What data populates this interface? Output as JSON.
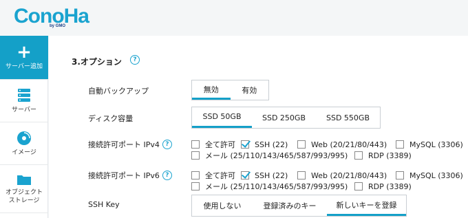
{
  "logo": {
    "text": "ConoHa",
    "sub": "by GMO"
  },
  "sidebar": {
    "items": [
      {
        "label": "サーバー追加",
        "icon": "plus-icon"
      },
      {
        "label": "サーバー",
        "icon": "server-icon"
      },
      {
        "label": "イメージ",
        "icon": "disc-icon"
      },
      {
        "label": "オブジェクト\nストレージ",
        "icon": "folder-icon"
      }
    ]
  },
  "section": {
    "title": "3.オプション",
    "help": "?"
  },
  "auto_backup": {
    "label": "自動バックアップ",
    "options": [
      "無効",
      "有効"
    ],
    "selected": 0
  },
  "disk": {
    "label": "ディスク容量",
    "options": [
      "SSD 50GB",
      "SSD 250GB",
      "SSD 550GB"
    ],
    "selected": 0
  },
  "ipv4": {
    "label": "接続許可ポート IPv4",
    "help": "?",
    "row1": [
      {
        "label": "全て許可",
        "checked": false
      },
      {
        "label": "SSH (22)",
        "checked": true
      },
      {
        "label": "Web (20/21/80/443)",
        "checked": false
      },
      {
        "label": "MySQL (3306)",
        "checked": false
      }
    ],
    "row2": [
      {
        "label": "メール (25/110/143/465/587/993/995)",
        "checked": false
      },
      {
        "label": "RDP (3389)",
        "checked": false
      }
    ]
  },
  "ipv6": {
    "label": "接続許可ポート IPv6",
    "help": "?",
    "row1": [
      {
        "label": "全て許可",
        "checked": false
      },
      {
        "label": "SSH (22)",
        "checked": true
      },
      {
        "label": "Web (20/21/80/443)",
        "checked": false
      },
      {
        "label": "MySQL (3306)",
        "checked": false
      }
    ],
    "row2": [
      {
        "label": "メール (25/110/143/465/587/993/995)",
        "checked": false
      },
      {
        "label": "RDP (3389)",
        "checked": false
      }
    ]
  },
  "ssh_key": {
    "label": "SSH Key",
    "options": [
      "使用しない",
      "登録済みのキー",
      "新しいキーを登録"
    ],
    "selected": 2
  },
  "colors": {
    "accent": "#14a0c8",
    "logo": "#1aa3cf"
  }
}
